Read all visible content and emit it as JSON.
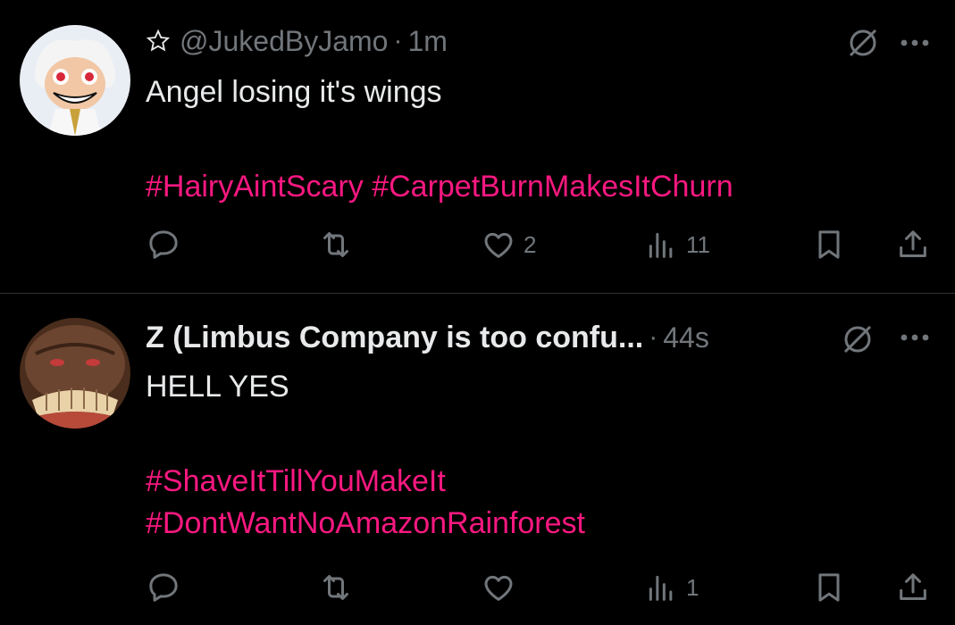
{
  "posts": [
    {
      "handle": "@JukedByJamo",
      "separator": "·",
      "time": "1m",
      "text": "Angel losing it's wings",
      "hashtags": [
        "#HairyAintScary #CarpetBurnMakesItChurn"
      ],
      "likes": "2",
      "views": "11",
      "avatar": "anime-character-avatar"
    },
    {
      "name": "Z (Limbus Company is too confu...",
      "separator": "·",
      "time": "44s",
      "text": "HELL YES",
      "hashtags": [
        "#ShaveItTillYouMakeIt",
        "#DontWantNoAmazonRainforest"
      ],
      "likes": "",
      "views": "1",
      "avatar": "grinning-face-avatar"
    }
  ],
  "colors": {
    "background": "#000000",
    "text": "#e7e9ea",
    "muted": "#71767b",
    "hashtag": "#f91880",
    "divider": "#2f3336"
  }
}
